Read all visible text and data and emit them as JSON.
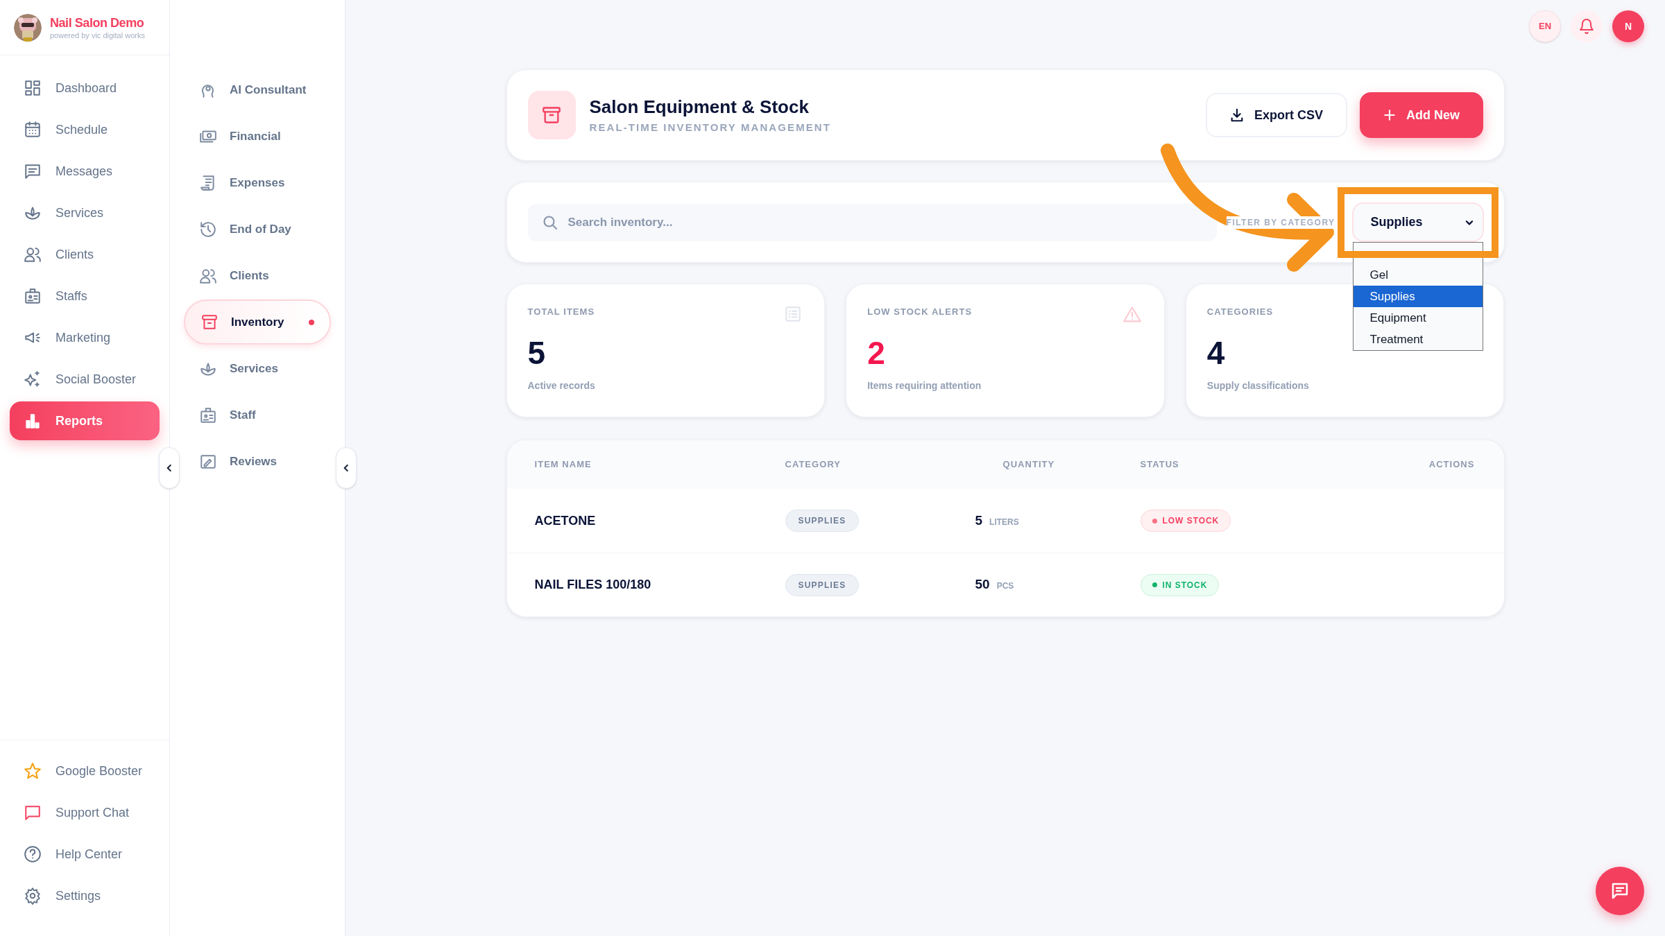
{
  "app": {
    "title": "Nail Salon Demo",
    "subtitle": "powered by vic digital works"
  },
  "sidebar": {
    "items": [
      {
        "label": "Dashboard",
        "selected": false
      },
      {
        "label": "Schedule",
        "selected": false
      },
      {
        "label": "Messages",
        "selected": false
      },
      {
        "label": "Services",
        "selected": false
      },
      {
        "label": "Clients",
        "selected": false
      },
      {
        "label": "Staffs",
        "selected": false
      },
      {
        "label": "Marketing",
        "selected": false
      },
      {
        "label": "Social Booster",
        "selected": false
      },
      {
        "label": "Reports",
        "selected": true
      }
    ],
    "footer_items": [
      {
        "label": "Google Booster"
      },
      {
        "label": "Support Chat"
      },
      {
        "label": "Help Center"
      },
      {
        "label": "Settings"
      }
    ]
  },
  "subnav": {
    "items": [
      {
        "label": "AI Consultant",
        "selected": false,
        "alert": false
      },
      {
        "label": "Financial",
        "selected": false,
        "alert": false
      },
      {
        "label": "Expenses",
        "selected": false,
        "alert": false
      },
      {
        "label": "End of Day",
        "selected": false,
        "alert": false
      },
      {
        "label": "Clients",
        "selected": false,
        "alert": false
      },
      {
        "label": "Inventory",
        "selected": true,
        "alert": true
      },
      {
        "label": "Services",
        "selected": false,
        "alert": false
      },
      {
        "label": "Staff",
        "selected": false,
        "alert": false
      },
      {
        "label": "Reviews",
        "selected": false,
        "alert": false
      }
    ]
  },
  "topbar": {
    "language": "EN",
    "avatar_initial": "N"
  },
  "header": {
    "title": "Salon Equipment & Stock",
    "subtitle": "REAL-TIME INVENTORY MANAGEMENT",
    "buttons": [
      {
        "label": "Export CSV",
        "kind": "secondary"
      },
      {
        "label": "Add New",
        "kind": "primary"
      }
    ]
  },
  "filters": {
    "search": {
      "placeholder": "Search inventory..."
    },
    "category_label": "FILTER BY CATEGORY",
    "category_select": {
      "value": "Supplies",
      "expanded": true,
      "options": [
        {
          "label": "Gel",
          "selected": false
        },
        {
          "label": "Supplies",
          "selected": true
        },
        {
          "label": "Equipment",
          "selected": false
        },
        {
          "label": "Treatment",
          "selected": false
        }
      ]
    }
  },
  "stats": [
    {
      "kind": "total",
      "label": "TOTAL ITEMS",
      "value": "5",
      "caption": "Active records"
    },
    {
      "kind": "alert",
      "label": "LOW STOCK ALERTS",
      "value": "2",
      "caption": "Items requiring attention"
    },
    {
      "kind": "categories",
      "label": "CATEGORIES",
      "value": "4",
      "caption": "Supply classifications"
    }
  ],
  "table": {
    "columns": [
      "ITEM NAME",
      "CATEGORY",
      "QUANTITY",
      "STATUS",
      "ACTIONS"
    ],
    "rows": [
      {
        "name": "ACETONE",
        "category": "SUPPLIES",
        "quantity": "5",
        "unit": "LITERS",
        "status": "LOW STOCK",
        "low_stock": true
      },
      {
        "name": "NAIL FILES 100/180",
        "category": "SUPPLIES",
        "quantity": "50",
        "unit": "PCS",
        "status": "IN STOCK",
        "low_stock": false
      }
    ]
  }
}
